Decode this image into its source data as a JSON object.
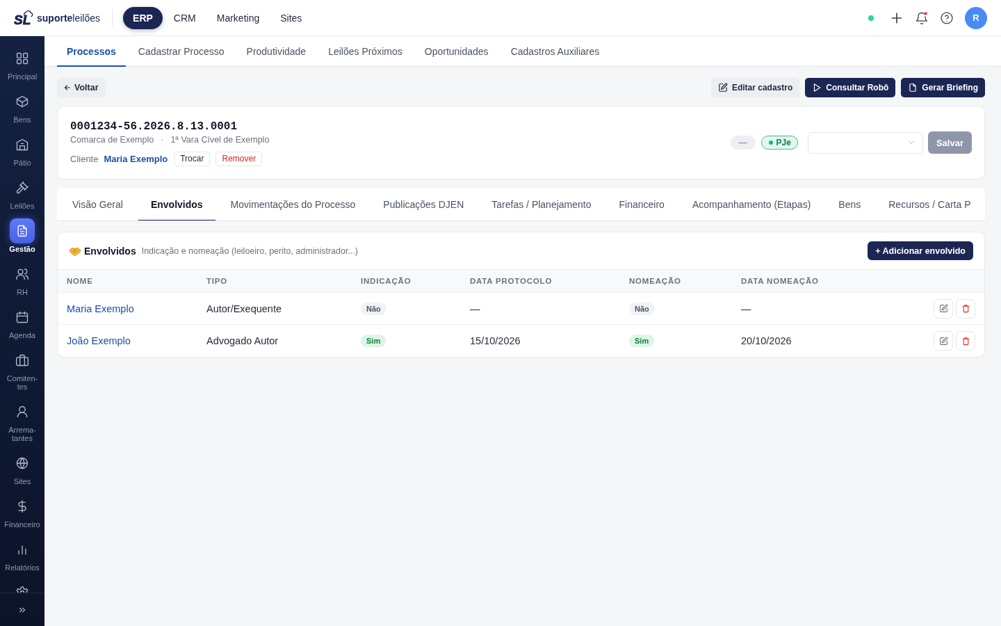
{
  "topbar": {
    "logo": {
      "mark": "SL",
      "name": "**suporte**leilões"
    },
    "modules": [
      {
        "label": "ERP",
        "selected": true
      },
      {
        "label": "CRM",
        "selected": false
      },
      {
        "label": "Marketing",
        "selected": false
      },
      {
        "label": "Sites",
        "selected": false
      }
    ],
    "online": true,
    "unread_notifications": true,
    "avatar": {
      "initial": "R"
    }
  },
  "sidebar": {
    "items": [
      {
        "label": "Principal",
        "selected": false
      },
      {
        "label": "Bens",
        "selected": false
      },
      {
        "label": "Pátio",
        "selected": false
      },
      {
        "label": "Leilões",
        "selected": false
      },
      {
        "label": "Gestão",
        "selected": true
      },
      {
        "label": "RH",
        "selected": false
      },
      {
        "label": "Agenda",
        "selected": false
      },
      {
        "label": "Comiten-tes",
        "selected": false
      },
      {
        "label": "Arrema-tantes",
        "selected": false
      },
      {
        "label": "Sites",
        "selected": false
      },
      {
        "label": "Financeiro",
        "selected": false
      },
      {
        "label": "Relatórios",
        "selected": false
      }
    ]
  },
  "subnav": {
    "tabs": [
      {
        "label": "Processos",
        "selected": true
      },
      {
        "label": "Cadastrar Processo",
        "selected": false
      },
      {
        "label": "Produtividade",
        "selected": false
      },
      {
        "label": "Leilões Próximos",
        "selected": false
      },
      {
        "label": "Oportunidades",
        "selected": false
      },
      {
        "label": "Cadastros Auxiliares",
        "selected": false
      }
    ]
  },
  "toolbar": {
    "back": "Voltar",
    "buttons": [
      {
        "label": "Editar cadastro",
        "kind": "secondary"
      },
      {
        "label": "Consultar Robô",
        "kind": "primary"
      },
      {
        "label": "Gerar Briefing",
        "kind": "primary"
      }
    ]
  },
  "process": {
    "number": "0001234-56.2026.8.13.0001",
    "comarca": "Comarca de Exemplo",
    "separator": "·",
    "vara": "1ª Vara Cível de Exemplo",
    "client_label": "Cliente",
    "client_name": "Maria Exemplo",
    "client_actions": [
      {
        "label": "Trocar",
        "kind": "neutral"
      },
      {
        "label": "Remover",
        "kind": "danger"
      }
    ],
    "badges": [
      {
        "text": "—",
        "kind": "neutral"
      },
      {
        "text": "PJe",
        "kind": "system"
      }
    ],
    "save": {
      "label": "Salvar",
      "disabled": true
    }
  },
  "tabs": [
    {
      "label": "Visão Geral",
      "selected": false
    },
    {
      "label": "Envolvidos",
      "selected": true
    },
    {
      "label": "Movimentações do Processo",
      "selected": false
    },
    {
      "label": "Publicações DJEN",
      "selected": false
    },
    {
      "label": "Tarefas / Planejamento",
      "selected": false
    },
    {
      "label": "Financeiro",
      "selected": false
    },
    {
      "label": "Acompanhamento (Etapas)",
      "selected": false
    },
    {
      "label": "Bens",
      "selected": false
    },
    {
      "label": "Recursos / Carta P",
      "selected": false
    }
  ],
  "envolvidos": {
    "title": "Envolvidos",
    "subtitle": "Indicação e nomeação (leiloeiro, perito, administrador...)",
    "add_button": "+ Adicionar envolvido",
    "table": {
      "columns": [
        "NOME",
        "TIPO",
        "INDICAÇÃO",
        "DATA PROTOCOLO",
        "NOMEAÇÃO",
        "DATA NOMEAÇÃO"
      ],
      "rows": [
        {
          "nome": "Maria Exemplo",
          "tipo": "Autor/Exequente",
          "indicacao": {
            "text": "Não",
            "positive": false
          },
          "data_protocolo": "—",
          "nomeacao": {
            "text": "Não",
            "positive": false
          },
          "data_nomeacao": "—"
        },
        {
          "nome": "João Exemplo",
          "tipo": "Advogado Autor",
          "indicacao": {
            "text": "Sim",
            "positive": true
          },
          "data_protocolo": "15/10/2026",
          "nomeacao": {
            "text": "Sim",
            "positive": true
          },
          "data_nomeacao": "20/10/2026"
        }
      ]
    }
  }
}
